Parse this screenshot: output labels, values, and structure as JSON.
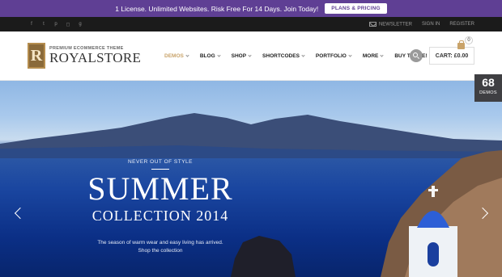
{
  "promo": {
    "text": "1 License. Unlimited Websites. Risk Free For 14 Days. Join Today!",
    "button": "PLANS & PRICING"
  },
  "topbar": {
    "social": [
      "facebook-icon",
      "twitter-icon",
      "pinterest-icon",
      "instagram-icon",
      "google-plus-icon"
    ],
    "links": {
      "newsletter": "NEWSLETTER",
      "signin": "SIGN IN",
      "register": "REGISTER"
    }
  },
  "logo": {
    "tagline": "PREMIUM ECOMMERCE THEME",
    "name": "ROYALSTORE",
    "mark": "R"
  },
  "nav": {
    "items": [
      {
        "label": "DEMOS",
        "dropdown": true,
        "active": true
      },
      {
        "label": "BLOG",
        "dropdown": true
      },
      {
        "label": "SHOP",
        "dropdown": true
      },
      {
        "label": "SHORTCODES",
        "dropdown": true
      },
      {
        "label": "PORTFOLIO",
        "dropdown": true
      },
      {
        "label": "MORE",
        "dropdown": true
      },
      {
        "label": "BUY THEME!",
        "dropdown": false
      }
    ]
  },
  "cart": {
    "label": "CART: £0.00",
    "count": "0"
  },
  "badge": {
    "number": "68",
    "label": "DEMOS"
  },
  "hero": {
    "eyebrow": "NEVER OUT OF STYLE",
    "headline": "SUMMER",
    "subheadline": "COLLECTION 2014",
    "line1": "The season of warm wear and easy living has arrived.",
    "line2": "Shop the collection"
  },
  "colors": {
    "promo": "#5f3f94",
    "accent": "#c9a36a",
    "topbar": "#1b1b1b"
  }
}
